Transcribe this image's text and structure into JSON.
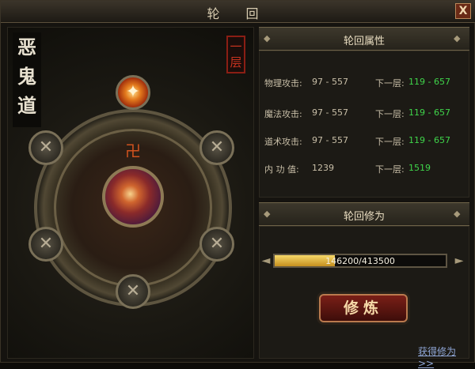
{
  "window": {
    "title": "轮 回",
    "close_label": "X"
  },
  "left_panel": {
    "realm_name": "恶鬼道",
    "layer_label": "一层",
    "rune_glyph": "卍",
    "node_glyph": "✕",
    "lit_node_glyph": "✦"
  },
  "attributes": {
    "header": "轮回属性",
    "rows": [
      {
        "label": "物理攻击:",
        "current": "97 - 557",
        "next_label": "下一层:",
        "next_value": "119 - 657"
      },
      {
        "label": "魔法攻击:",
        "current": "97 - 557",
        "next_label": "下一层:",
        "next_value": "119 - 657"
      },
      {
        "label": "道术攻击:",
        "current": "97 - 557",
        "next_label": "下一层:",
        "next_value": "119 - 657"
      },
      {
        "label": "内 功 值:",
        "current": "1239",
        "next_label": "下一层:",
        "next_value": "1519"
      }
    ]
  },
  "cultivation": {
    "header": "轮回修为",
    "progress_text": "146200/413500",
    "progress_fraction": 0.354,
    "button_label": "修炼",
    "obtain_link": "获得修为>>"
  },
  "colors": {
    "accent_green": "#3fd44a",
    "progress_gold": "#e0b53c",
    "button_red": "#7a1f17"
  }
}
